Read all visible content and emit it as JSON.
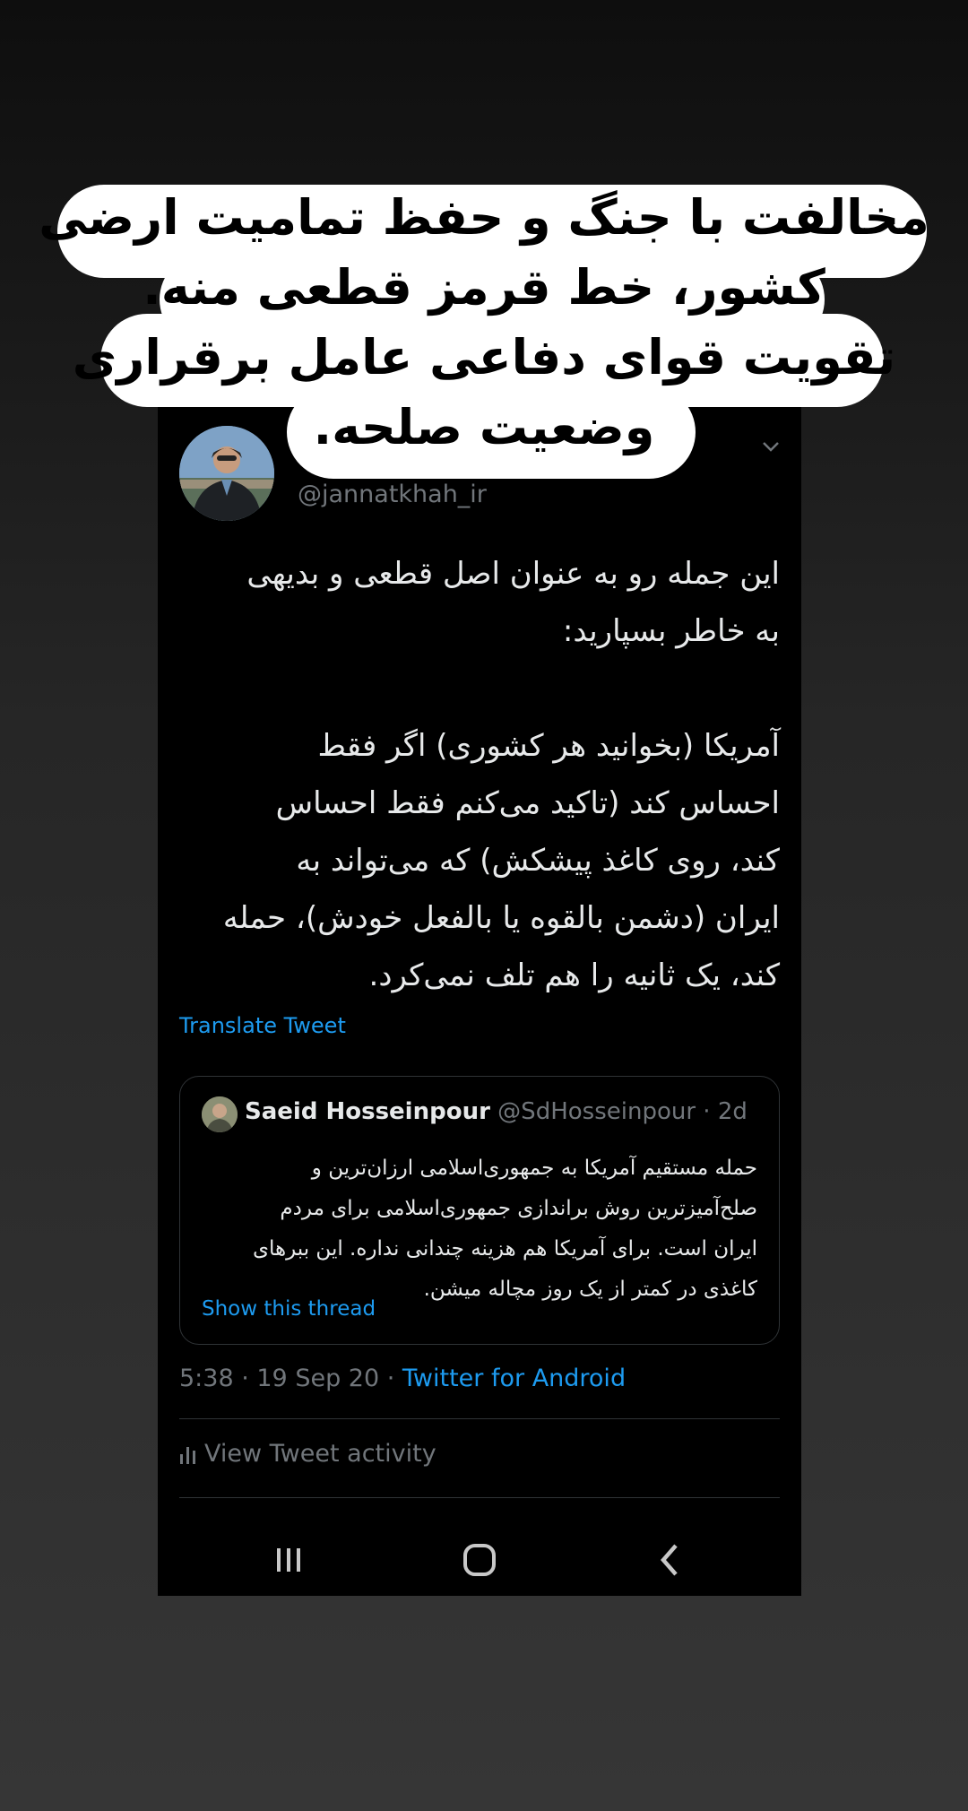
{
  "caption": {
    "line1": "مخالفت با جنگ و حفظ تمامیت ارضی",
    "line2": "کشور، خط قرمز قطعی منه.",
    "line3": "تقویت قوای دفاعی عامل برقراری",
    "line4": "وضعیت صلحه."
  },
  "tweet": {
    "handle": "@jannatkhah_ir",
    "text_p1_l1": "این جمله رو به عنوان اصل قطعی و بدیهی",
    "text_p1_l2": "به خاطر بسپارید:",
    "text_p2_l1": "آمریکا (بخوانید هر کشوری) اگر فقط",
    "text_p2_l2": "احساس کند (تاکید می‌کنم فقط احساس",
    "text_p2_l3": "کند، روی کاغذ پیشکش) که می‌تواند به",
    "text_p2_l4": "ایران (دشمن بالقوه یا بالفعل خودش)، حمله",
    "text_p2_l5": "کند، یک ثانیه را هم تلف نمی‌کرد.",
    "translate_label": "Translate Tweet",
    "time": "5:38 · 19 Sep 20 · ",
    "source": "Twitter for Android",
    "activity_label": "View Tweet activity",
    "icons": {
      "menu": "chevron-down-icon",
      "activity": "bar-chart-icon"
    }
  },
  "quoted": {
    "name": "Saeid Hosseinpour",
    "meta": " @SdHosseinpour · 2d",
    "text_l1": "حمله مستقیم آمریکا به جمهوری‌اسلامی ارزان‌ترین و",
    "text_l2": "صلح‌آمیزترین روش براندازی جمهوری‌اسلامی برای مردم",
    "text_l3": "ایران است. برای آمریکا هم هزینه چندانی نداره. این ببرهای",
    "text_l4": "کاغذی در کمتر از یک روز مچاله میشن.",
    "show_thread_label": "Show this thread"
  },
  "nav": {
    "icons": [
      "recent-apps-icon",
      "home-icon",
      "back-icon"
    ]
  },
  "colors": {
    "link": "#1d9bf0",
    "secondary_text": "#71767b",
    "primary_text": "#e7e9ea",
    "caption_bg": "#ffffff"
  }
}
